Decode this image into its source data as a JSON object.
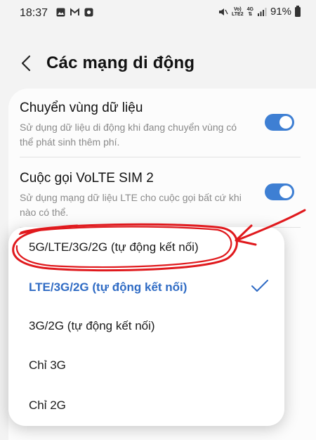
{
  "status": {
    "time": "18:37",
    "volte_tag_top": "Vo)",
    "volte_tag_bottom": "LTE2",
    "net_tag": "4G",
    "battery": "91%"
  },
  "header": {
    "title": "Các mạng di động"
  },
  "settings": [
    {
      "title": "Chuyển vùng dữ liệu",
      "description": "Sử dụng dữ liệu di động khi đang chuyển vùng có thể phát sinh thêm phí.",
      "enabled": true
    },
    {
      "title": "Cuộc gọi VoLTE SIM 2",
      "description": "Sử dụng mạng dữ liệu LTE cho cuộc gọi bất cứ khi nào có thể.",
      "enabled": true
    }
  ],
  "network_mode_options": [
    {
      "label": "5G/LTE/3G/2G (tự động kết nối)",
      "selected": false
    },
    {
      "label": "LTE/3G/2G (tự động kết nối)",
      "selected": true
    },
    {
      "label": "3G/2G (tự động kết nối)",
      "selected": false
    },
    {
      "label": "Chỉ 3G",
      "selected": false
    },
    {
      "label": "Chỉ 2G",
      "selected": false
    }
  ],
  "colors": {
    "accent": "#3e7fd3",
    "selected_text": "#2f6bc4",
    "annotation": "#e0191d"
  },
  "icons": [
    "gallery-icon",
    "gmail-icon",
    "app-icon",
    "mute-icon",
    "signal-icon",
    "battery-icon",
    "back-arrow-icon",
    "check-icon"
  ]
}
